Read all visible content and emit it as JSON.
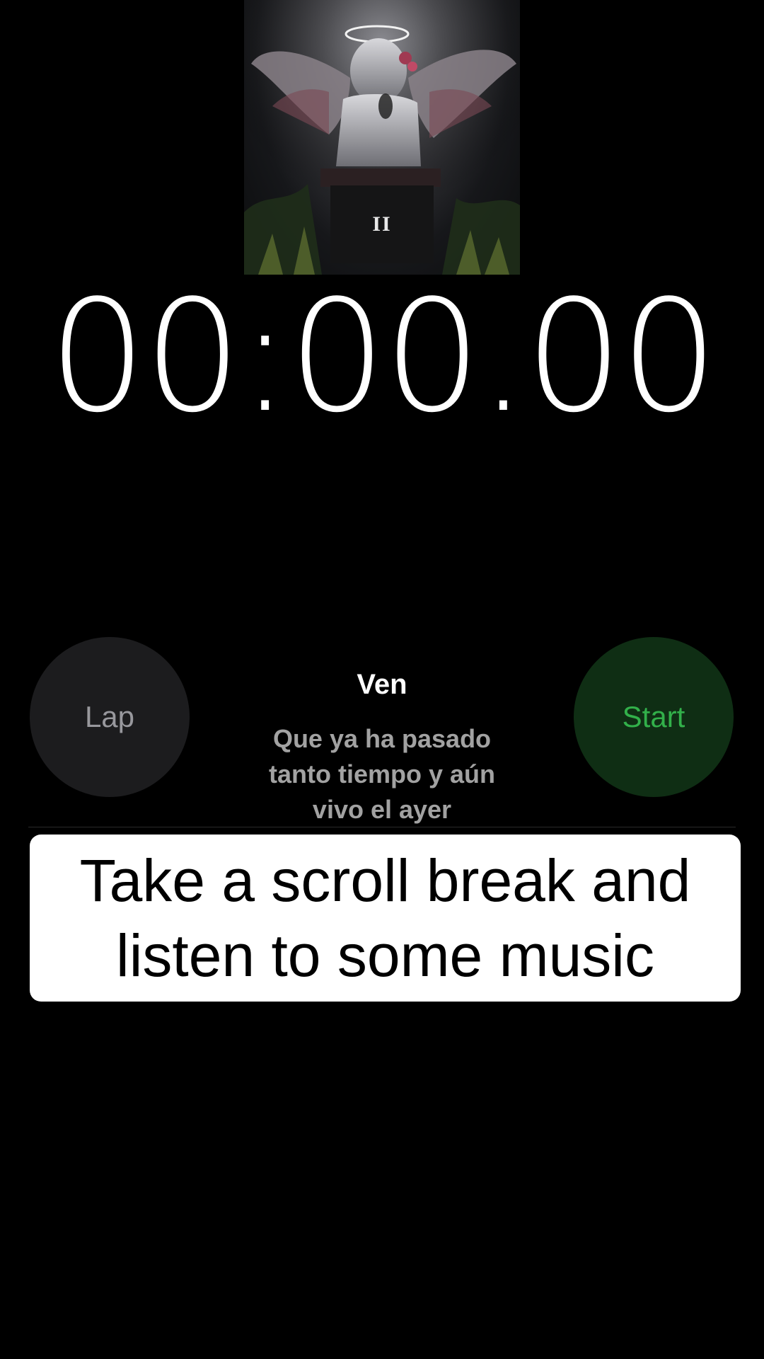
{
  "album": {
    "numeral": "II"
  },
  "stopwatch": {
    "time": "00:00.00",
    "lap_label": "Lap",
    "start_label": "Start"
  },
  "now_playing": {
    "title": "Ven",
    "lyrics_line_1": "Que ya ha pasado",
    "lyrics_line_2": "tanto tiempo y aún",
    "lyrics_line_3": "vivo el ayer"
  },
  "caption": {
    "line_1": "Take a scroll break and",
    "line_2": "listen to some music"
  },
  "colors": {
    "background": "#000000",
    "lap_button_bg": "#1c1c1e",
    "start_button_bg": "#0f2e14",
    "start_text": "#32b04a",
    "caption_bg": "#ffffff"
  }
}
